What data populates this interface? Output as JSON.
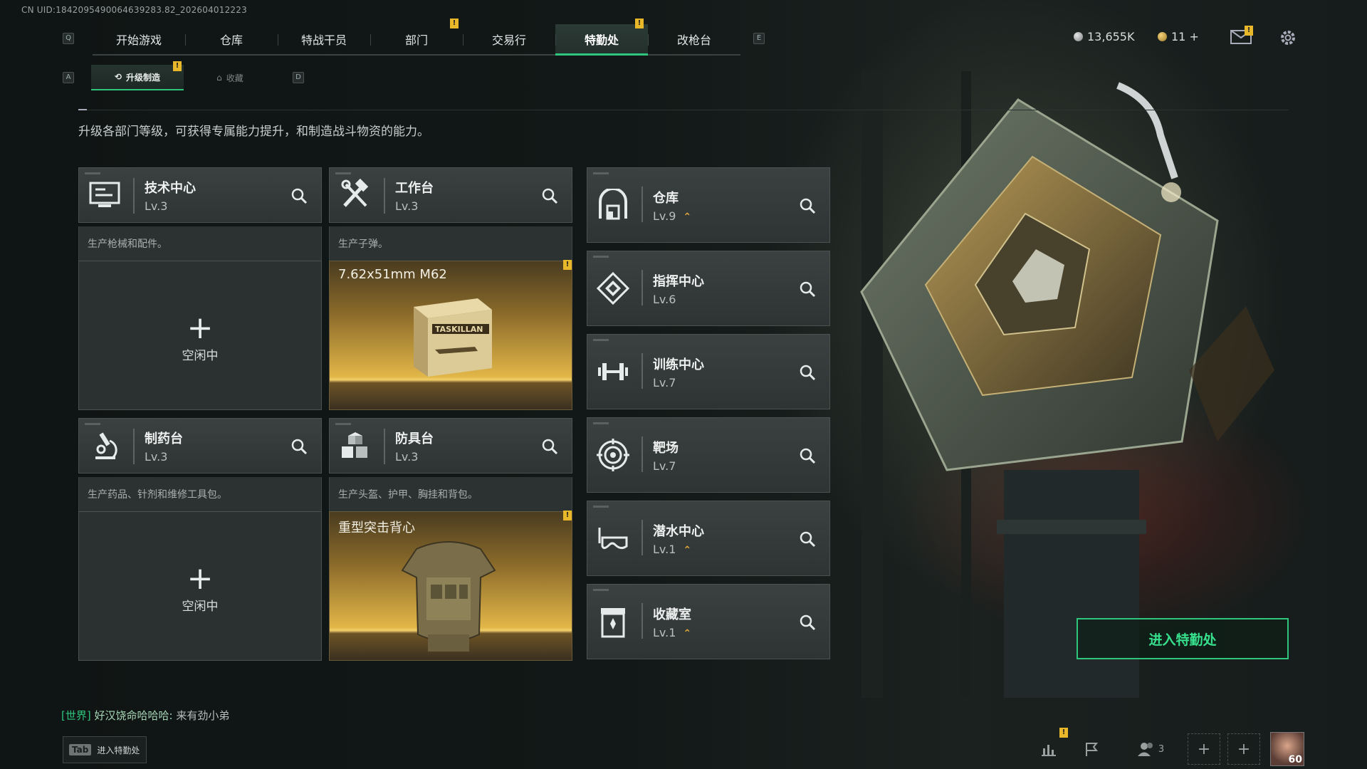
{
  "uid": "CN UID:1842095490064639283.82_202604012223",
  "nav": {
    "key_left": "Q",
    "key_right": "E",
    "tabs": [
      "开始游戏",
      "仓库",
      "特战干员",
      "部门",
      "交易行",
      "特勤处",
      "改枪台"
    ],
    "active_tab": "特勤处"
  },
  "currency": {
    "silver": "13,655K",
    "gold": "11 +"
  },
  "subnav": {
    "key_left": "A",
    "key_right": "D",
    "tabs": [
      "升级制造",
      "收藏"
    ],
    "active": "升级制造"
  },
  "description": "升级各部门等级，可获得专属能力提升，和制造战斗物资的能力。",
  "left_cards": [
    {
      "name": "技术中心",
      "level": "Lv.3",
      "desc": "生产枪械和配件。",
      "slot": {
        "state": "idle",
        "plus": "+",
        "label": "空闲中"
      }
    },
    {
      "name": "工作台",
      "level": "Lv.3",
      "desc": "生产子弹。",
      "slot": {
        "state": "producing",
        "title": "7.62x51mm M62"
      }
    },
    {
      "name": "制药台",
      "level": "Lv.3",
      "desc": "生产药品、针剂和维修工具包。",
      "slot": {
        "state": "idle",
        "plus": "+",
        "label": "空闲中"
      }
    },
    {
      "name": "防具台",
      "level": "Lv.3",
      "desc": "生产头盔、护甲、胸挂和背包。",
      "slot": {
        "state": "producing",
        "title": "重型突击背心"
      }
    }
  ],
  "right_cards": [
    {
      "name": "仓库",
      "level": "Lv.9",
      "upgrade": true,
      "icon": "warehouse-icon"
    },
    {
      "name": "指挥中心",
      "level": "Lv.6",
      "upgrade": false,
      "icon": "command-center-icon"
    },
    {
      "name": "训练中心",
      "level": "Lv.7",
      "upgrade": false,
      "icon": "dumbbell-icon"
    },
    {
      "name": "靶场",
      "level": "Lv.7",
      "upgrade": false,
      "icon": "target-icon"
    },
    {
      "name": "潜水中心",
      "level": "Lv.1",
      "upgrade": true,
      "icon": "diving-mask-icon"
    },
    {
      "name": "收藏室",
      "level": "Lv.1",
      "upgrade": true,
      "icon": "collection-icon"
    }
  ],
  "box_label": "TASKILLAN",
  "enter_button": "进入特勤处",
  "chat": {
    "channel": "[世界]",
    "sender": "好汉饶命哈哈哈:",
    "message": "来有劲小弟"
  },
  "tab_hint": {
    "key": "Tab",
    "label": "进入特勤处"
  },
  "friends_count": "3",
  "player_level": "60",
  "colors": {
    "accent": "#2ec57d",
    "warning": "#e8b82a",
    "upgrade": "#e0a93c"
  }
}
